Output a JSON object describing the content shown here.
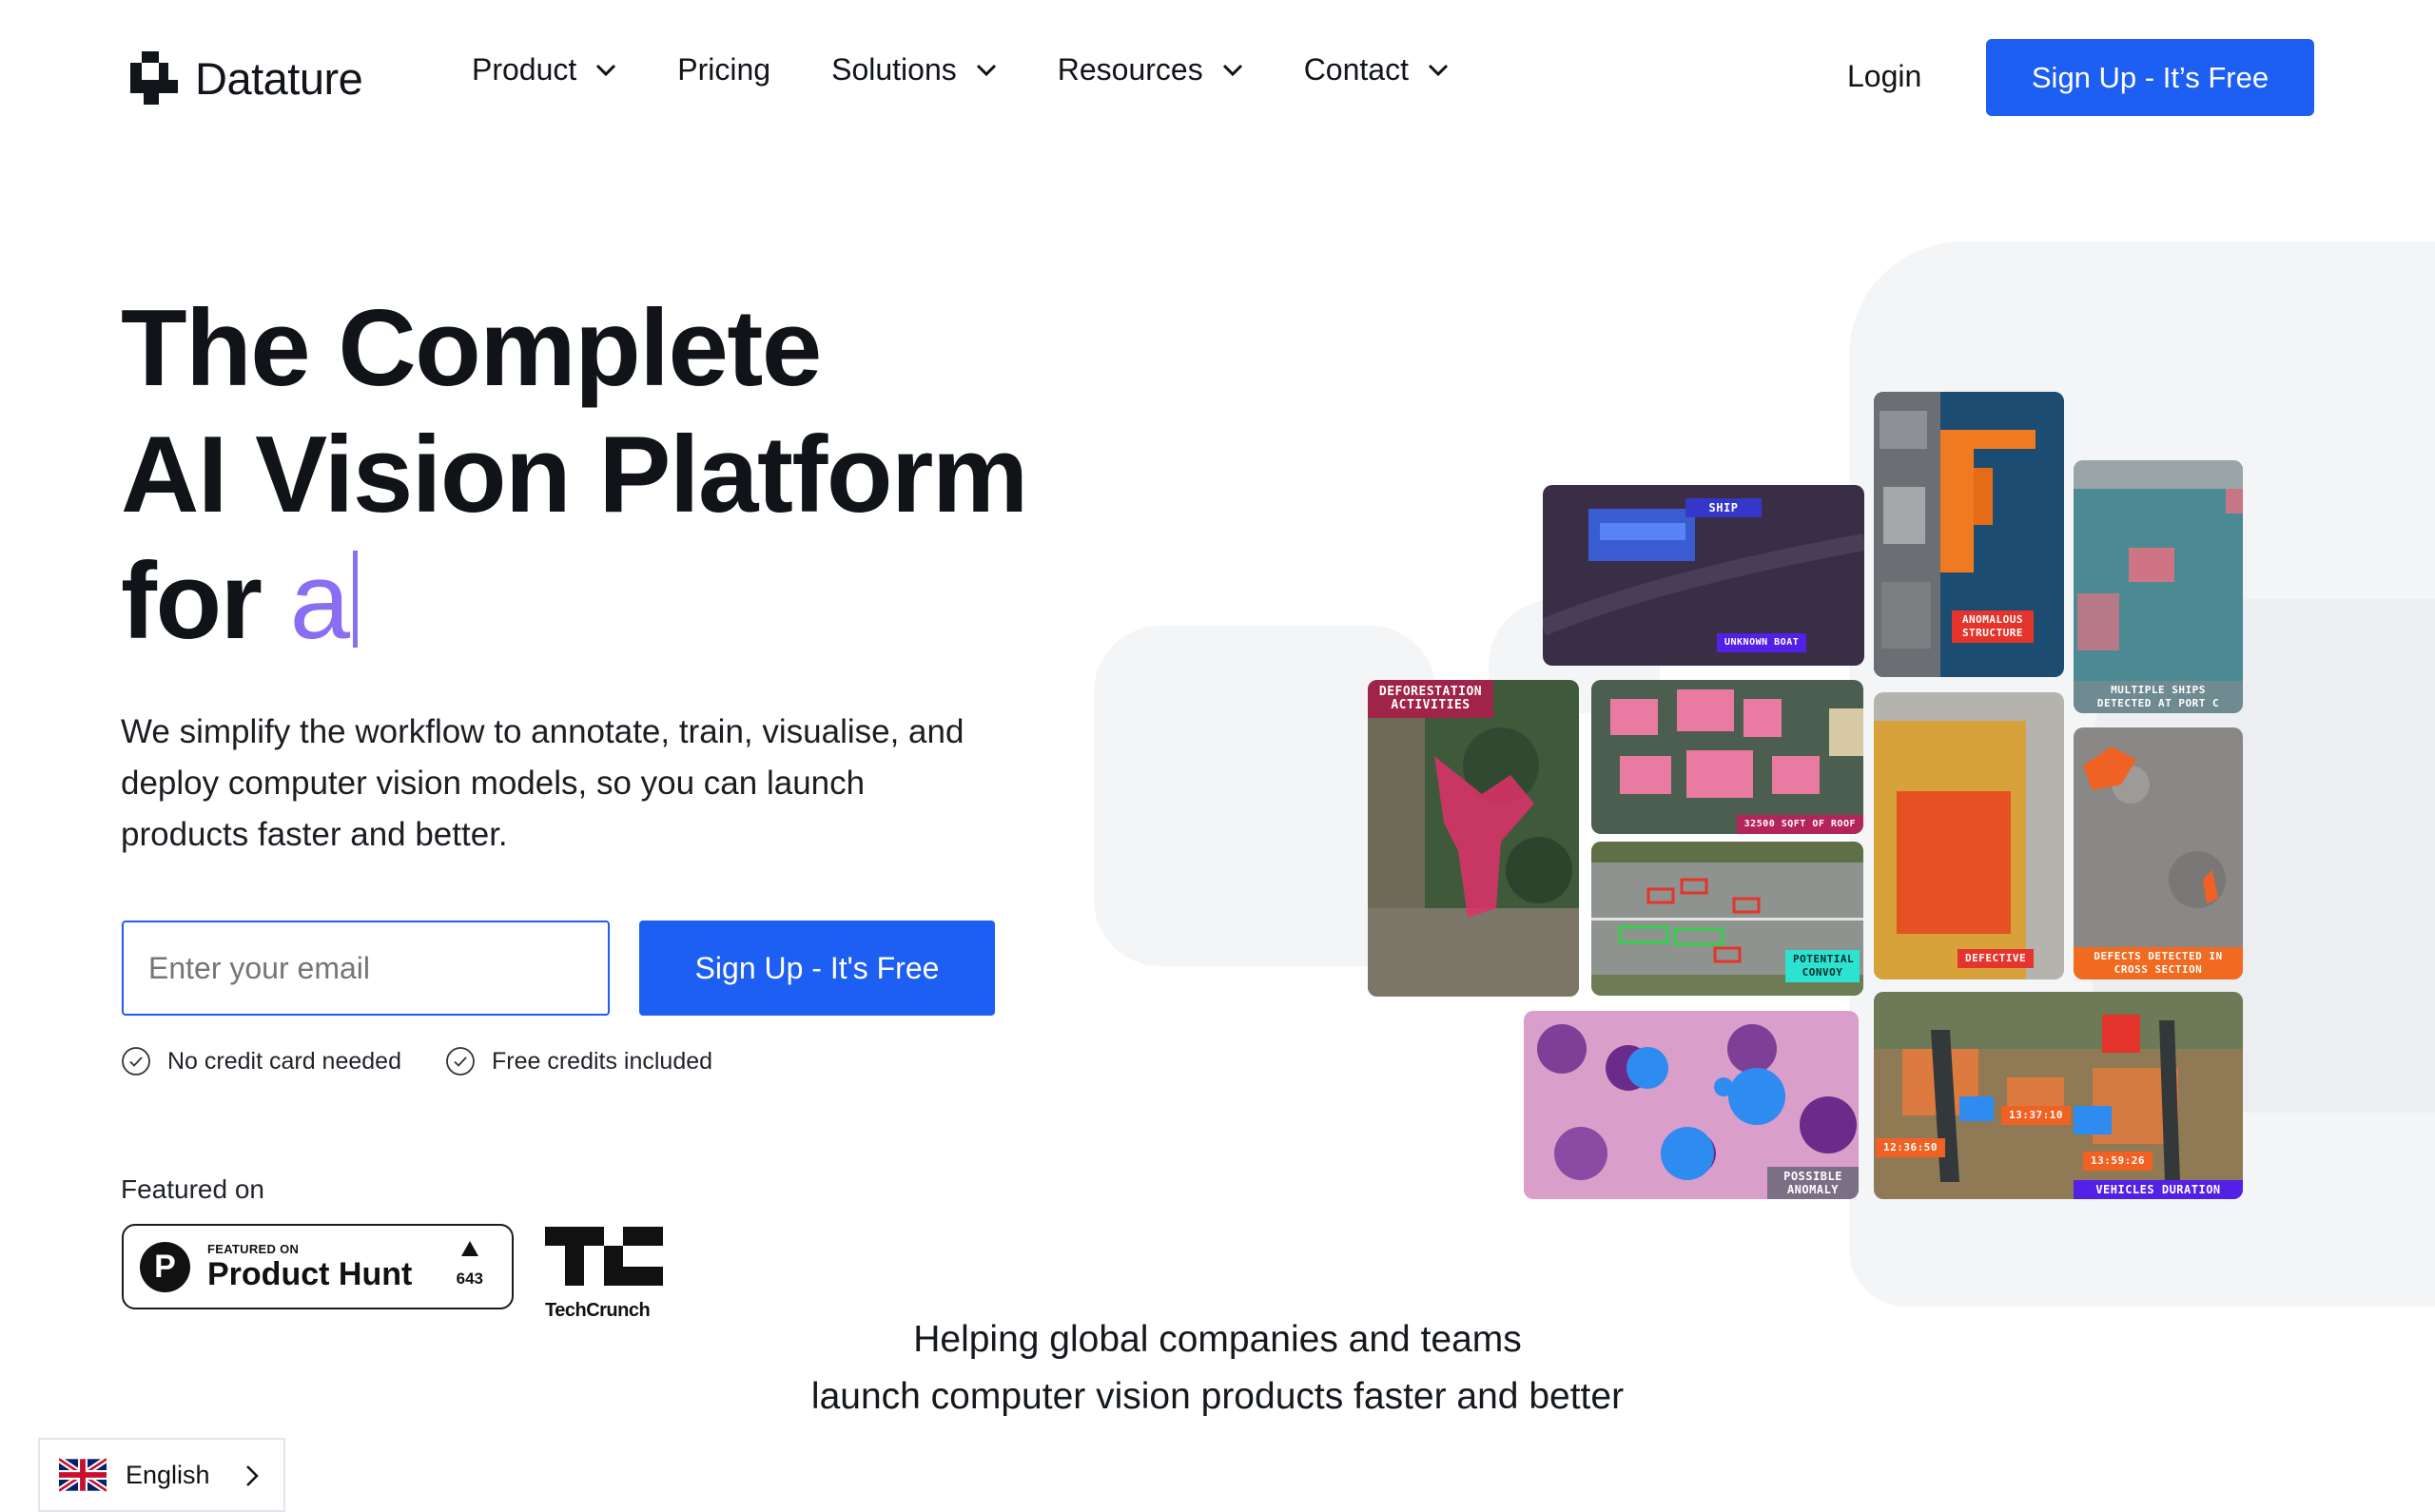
{
  "brand": {
    "name": "Datature"
  },
  "nav": {
    "items": [
      {
        "label": "Product",
        "dropdown": true
      },
      {
        "label": "Pricing",
        "dropdown": false
      },
      {
        "label": "Solutions",
        "dropdown": true
      },
      {
        "label": "Resources",
        "dropdown": true
      },
      {
        "label": "Contact",
        "dropdown": true
      }
    ],
    "login": "Login",
    "signup": "Sign Up - It’s Free"
  },
  "hero": {
    "title_line1": "The Complete",
    "title_line2": "AI Vision Platform",
    "title_line3_prefix": "for",
    "typed_text": "a",
    "subtitle": "We simplify the workflow to annotate, train, visualise, and deploy computer vision models, so you can launch products faster and better.",
    "email_placeholder": "Enter your email",
    "signup_button": "Sign Up - It's Free",
    "checks": [
      "No credit card needed",
      "Free credits included"
    ],
    "featured_label": "Featured on"
  },
  "badges": {
    "product_hunt": {
      "small": "FEATURED ON",
      "name": "Product Hunt",
      "votes": "643"
    },
    "techcrunch": {
      "name": "TechCrunch"
    }
  },
  "collage": {
    "tags": {
      "ship": "SHIP",
      "unknown_boat": "UNKNOWN BOAT",
      "anomalous_structure": "ANOMALOUS STRUCTURE",
      "multiple_ships": "MULTIPLE SHIPS DETECTED AT PORT C",
      "deforestation": "DEFORESTATION ACTIVITIES",
      "roof": "32500 SQFT OF ROOF",
      "convoy": "POTENTIAL CONVOY",
      "defective": "DEFECTIVE",
      "defects_cross": "DEFECTS DETECTED IN CROSS SECTION",
      "possible_anomaly": "POSSIBLE ANOMALY",
      "vehicles_duration": "VEHICLES DURATION",
      "time1": "13:37:10",
      "time2": "12:36:50",
      "time3": "13:59:26"
    }
  },
  "helping": {
    "line1": "Helping global companies and teams",
    "line2": "launch computer vision products faster and better"
  },
  "language": {
    "label": "English"
  },
  "colors": {
    "accent": "#1d5ef3",
    "typed": "#8a6ef2",
    "background_shape": "#f4f5f7"
  }
}
